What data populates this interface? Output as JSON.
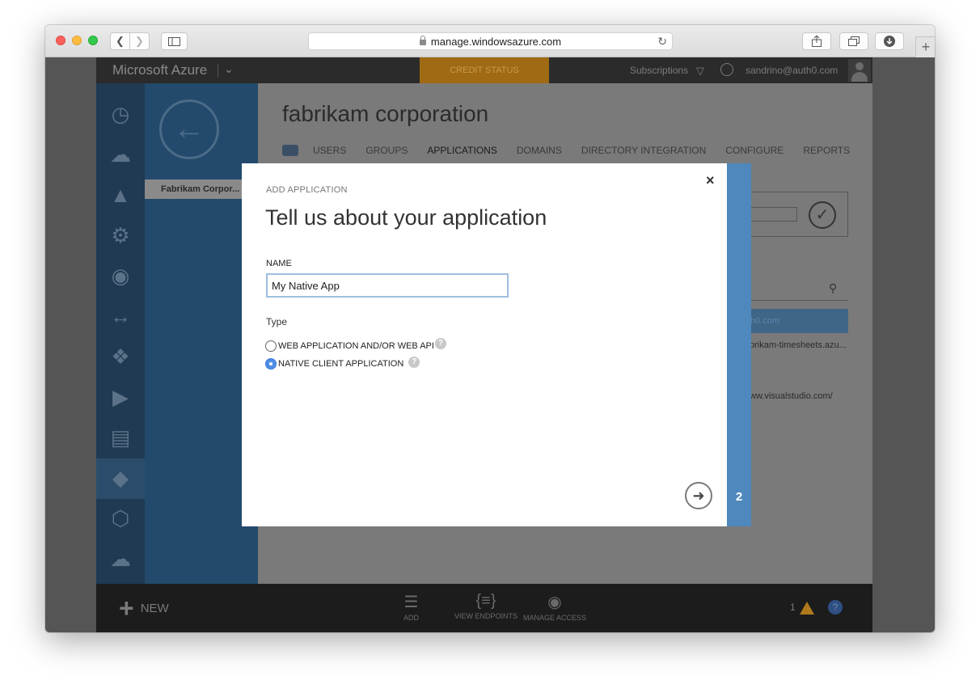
{
  "browser": {
    "url": "manage.windowsazure.com",
    "back_icon": "chevron-left-icon",
    "forward_icon": "chevron-right-icon",
    "newtab_label": "+"
  },
  "azure": {
    "brand": "Microsoft Azure",
    "credit_status": "CREDIT STATUS",
    "subscriptions": "Subscriptions",
    "user": "sandrino@auth0.com",
    "subnav_item": "Fabrikam Corpor...",
    "directory_title": "fabrikam corporation",
    "tabs": [
      "USERS",
      "GROUPS",
      "APPLICATIONS",
      "DOMAINS",
      "DIRECTORY INTEGRATION",
      "CONFIGURE",
      "REPORTS"
    ],
    "active_tab": "APPLICATIONS",
    "selected_row": "th0.com",
    "row1": "brikam-timesheets.azu...",
    "row2": "ww.visualstudio.com/",
    "bottom": {
      "new": "NEW",
      "add": "ADD",
      "view_endpoints": "VIEW ENDPOINTS",
      "manage_access": "MANAGE ACCESS",
      "warning_count": "1",
      "help": "?"
    }
  },
  "modal": {
    "section": "ADD APPLICATION",
    "title": "Tell us about your application",
    "name_label": "NAME",
    "name_value": "My Native App",
    "type_label": "Type",
    "options": [
      {
        "label": "WEB APPLICATION AND/OR WEB API",
        "selected": false
      },
      {
        "label": "NATIVE CLIENT APPLICATION",
        "selected": true
      }
    ],
    "close": "×",
    "step": "2",
    "next_icon": "arrow-right-icon"
  },
  "colors": {
    "modal_accent": "#4e88bd",
    "radio_selected": "#4f8fe8"
  }
}
